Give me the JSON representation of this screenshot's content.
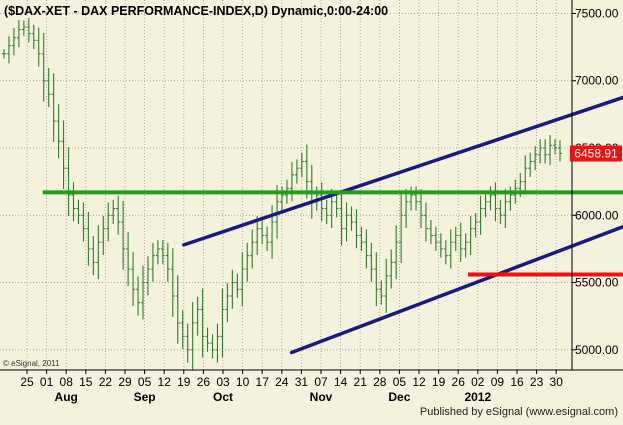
{
  "chart_data": {
    "type": "line",
    "title": "($DAX-XET - DAX PERFORMANCE-INDEX,D) Dynamic,0:00-24:00",
    "symbol": "$DAX-XET",
    "last_value": "6458.91",
    "ylim": [
      4850,
      7600
    ],
    "y_ticks": [
      {
        "value": 5000,
        "label": "5000.00"
      },
      {
        "value": 5500,
        "label": "5500.00"
      },
      {
        "value": 6000,
        "label": "6000.00"
      },
      {
        "value": 6500,
        "label": "6500.00"
      },
      {
        "value": 7000,
        "label": "7000.00"
      },
      {
        "value": 7500,
        "label": "7500.00"
      }
    ],
    "x_ticks": [
      "25",
      "01",
      "08",
      "15",
      "22",
      "29",
      "05",
      "12",
      "19",
      "26",
      "03",
      "10",
      "17",
      "24",
      "31",
      "07",
      "14",
      "21",
      "28",
      "05",
      "12",
      "19",
      "26",
      "02",
      "09",
      "16",
      "23",
      "30"
    ],
    "month_labels": [
      {
        "label": "Aug",
        "tick_index": 2
      },
      {
        "label": "Sep",
        "tick_index": 6
      },
      {
        "label": "Oct",
        "tick_index": 10
      },
      {
        "label": "Nov",
        "tick_index": 15
      },
      {
        "label": "Dec",
        "tick_index": 19
      },
      {
        "label": "2012",
        "tick_index": 23
      }
    ],
    "series": [
      {
        "style": "ohlc-bars",
        "color": "#2e7d2e",
        "values": [
          7200,
          7260,
          7320,
          7380,
          7400,
          7350,
          7300,
          7200,
          7000,
          6900,
          6700,
          6550,
          6350,
          6150,
          6050,
          6000,
          5900,
          5750,
          5650,
          5800,
          5900,
          6000,
          6050,
          5950,
          5750,
          5600,
          5450,
          5350,
          5500,
          5600,
          5700,
          5750,
          5700,
          5600,
          5400,
          5200,
          5100,
          5000,
          5200,
          5300,
          5100,
          5050,
          5000,
          5100,
          5300,
          5400,
          5500,
          5450,
          5600,
          5700,
          5800,
          5900,
          5850,
          5800,
          5950,
          6100,
          6150,
          6200,
          6300,
          6350,
          6400,
          6250,
          6100,
          6150,
          6050,
          6000,
          6100,
          6050,
          5900,
          6000,
          5950,
          5850,
          5800,
          5700,
          5600,
          5450,
          5400,
          5550,
          5650,
          5800,
          6000,
          6100,
          6150,
          6100,
          6000,
          5900,
          5850,
          5800,
          5750,
          5700,
          5800,
          5850,
          5750,
          5800,
          5900,
          5950,
          6050,
          6100,
          6150,
          6050,
          6000,
          6100,
          6150,
          6200,
          6250,
          6350,
          6400,
          6450,
          6500,
          6450,
          6520,
          6500,
          6460
        ]
      }
    ],
    "annotations": [
      {
        "type": "trendline",
        "color": "#1a1a7e",
        "x1": 8.0,
        "y1": 5780,
        "x2": 30.5,
        "y2": 6880
      },
      {
        "type": "trendline",
        "color": "#1a1a7e",
        "x1": 13.5,
        "y1": 4980,
        "x2": 30.5,
        "y2": 5920
      },
      {
        "type": "horizontal",
        "color": "#1aa01a",
        "x1": 0.8,
        "x2": 30.5,
        "y": 6170
      },
      {
        "type": "horizontal",
        "color": "#ee1111",
        "x1": 22.5,
        "x2": 30.5,
        "y": 5560
      }
    ],
    "grid": true,
    "background": "#f4f1dc",
    "last_value_box_color": "#ee1111"
  },
  "footer": {
    "copyright": "© eSignal, 2011",
    "published": "Published by eSignal (www.esignal.com)"
  }
}
